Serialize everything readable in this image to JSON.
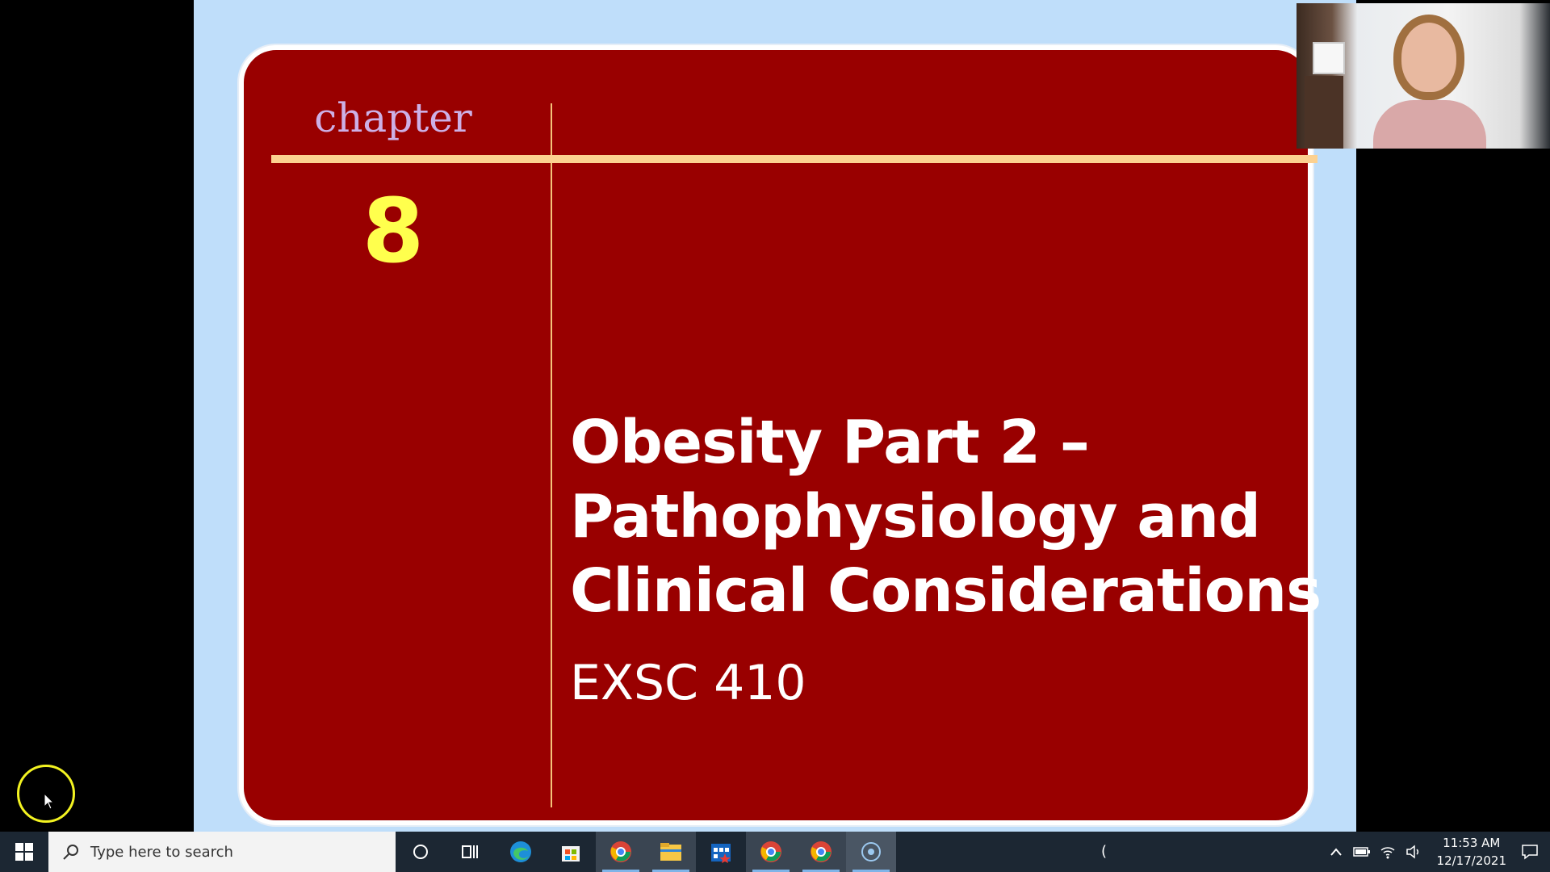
{
  "slide": {
    "chapter_word": "chapter",
    "chapter_number": "8",
    "title_lines": [
      "Obesity Part 2 –",
      "Pathophysiology and",
      "Clinical Considerations"
    ],
    "subtitle": "EXSC 410",
    "colors": {
      "slide_background": "#990000",
      "outer_background": "#bfdefa",
      "accent_rule": "#fcd190",
      "chapter_word": "#cdb0e6",
      "chapter_number": "#ffff4d"
    }
  },
  "webcam": {
    "label": "presenter-webcam"
  },
  "taskbar": {
    "search_placeholder": "Type here to search",
    "apps": [
      {
        "name": "cortana-icon"
      },
      {
        "name": "task-view-icon"
      },
      {
        "name": "edge-icon"
      },
      {
        "name": "store-icon"
      },
      {
        "name": "chrome-icon"
      },
      {
        "name": "file-explorer-icon"
      },
      {
        "name": "calendar-app-icon"
      },
      {
        "name": "chrome-profile-2-icon"
      },
      {
        "name": "chrome-profile-3-icon"
      },
      {
        "name": "recording-app-icon"
      }
    ],
    "clock": {
      "time": "11:53 AM",
      "date": "12/17/2021"
    },
    "stray_glyph": "("
  }
}
